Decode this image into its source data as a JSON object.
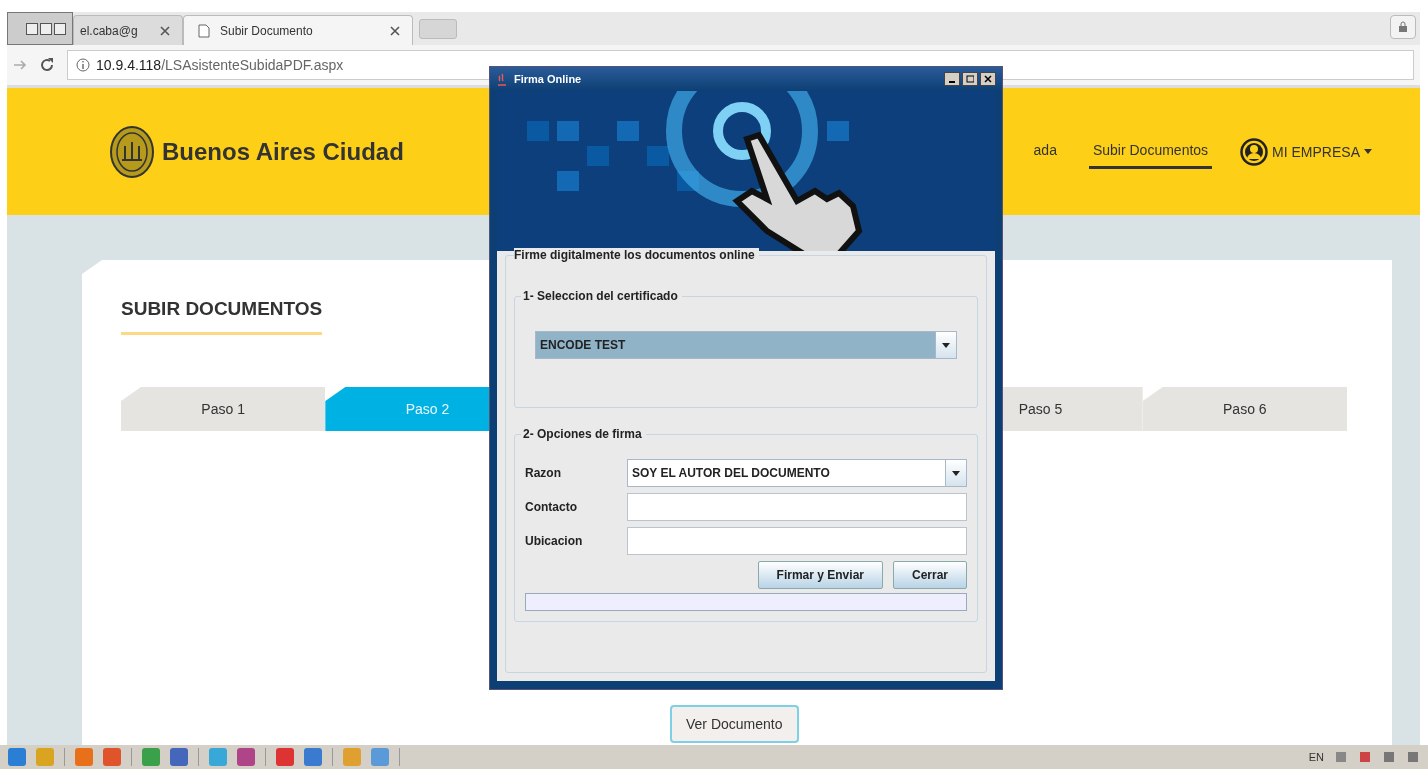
{
  "browser": {
    "tabs": [
      {
        "title": "el.caba@g",
        "selected": false
      },
      {
        "title": "Subir Documento",
        "selected": true
      }
    ],
    "address": {
      "host": "10.9.4.118",
      "path": "/LSAsistenteSubidaPDF.aspx"
    }
  },
  "header": {
    "brand": "Buenos Aires Ciudad",
    "nav": [
      {
        "label": "ada",
        "selected": false
      },
      {
        "label": "Subir Documentos",
        "selected": true
      }
    ],
    "account": "MI EMPRESA"
  },
  "page": {
    "title": "SUBIR DOCUMENTOS",
    "steps": [
      {
        "label": "Paso 1",
        "selected": false
      },
      {
        "label": "Paso 2",
        "selected": true
      },
      {
        "label": "Paso 5",
        "selected": false
      },
      {
        "label": "Paso 6",
        "selected": false
      }
    ],
    "view_button": "Ver Documento"
  },
  "dialog": {
    "title": "Firma Online",
    "group": "Firme digitalmente los documentos online",
    "certificate": {
      "legend": "1- Seleccion del certificado",
      "value": "ENCODE TEST"
    },
    "options": {
      "legend": "2- Opciones de firma",
      "fields": [
        {
          "kind": "combo",
          "label": "Razon",
          "value": "SOY EL AUTOR DEL DOCUMENTO"
        },
        {
          "kind": "text",
          "label": "Contacto"
        },
        {
          "kind": "text",
          "label": "Ubicacion"
        }
      ],
      "buttons": [
        "Firmar y Enviar",
        "Cerrar"
      ],
      "progress": {
        "level": 0
      }
    }
  },
  "taskbar": {
    "language": "EN"
  }
}
